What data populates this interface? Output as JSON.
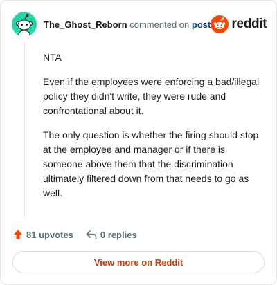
{
  "header": {
    "username": "The_Ghost_Reborn",
    "action_text": "commented on",
    "post_link": "post",
    "logo_text": "reddit"
  },
  "comment": {
    "paragraphs": [
      "NTA",
      "Even if the employees were enforcing a bad/illegal policy they didn't write, they were rude and confrontational about it.",
      "The only question is whether the firing should stop at the employee and manager or if there is someone above them that the discrimination ultimately filtered down from that needs to go as well."
    ]
  },
  "actions": {
    "upvotes": "81 upvotes",
    "replies": "0 replies"
  },
  "footer": {
    "view_more": "View more on Reddit"
  },
  "colors": {
    "avatar_bg": "#24d6a7",
    "brand_orange": "#ff4500",
    "link_blue": "#0a449b",
    "view_more_text": "#d93900"
  },
  "icons": {
    "avatar": "snoo-avatar-icon",
    "logo": "reddit-logo-icon",
    "upvote": "upvote-arrow-icon",
    "reply": "reply-arrow-icon"
  }
}
